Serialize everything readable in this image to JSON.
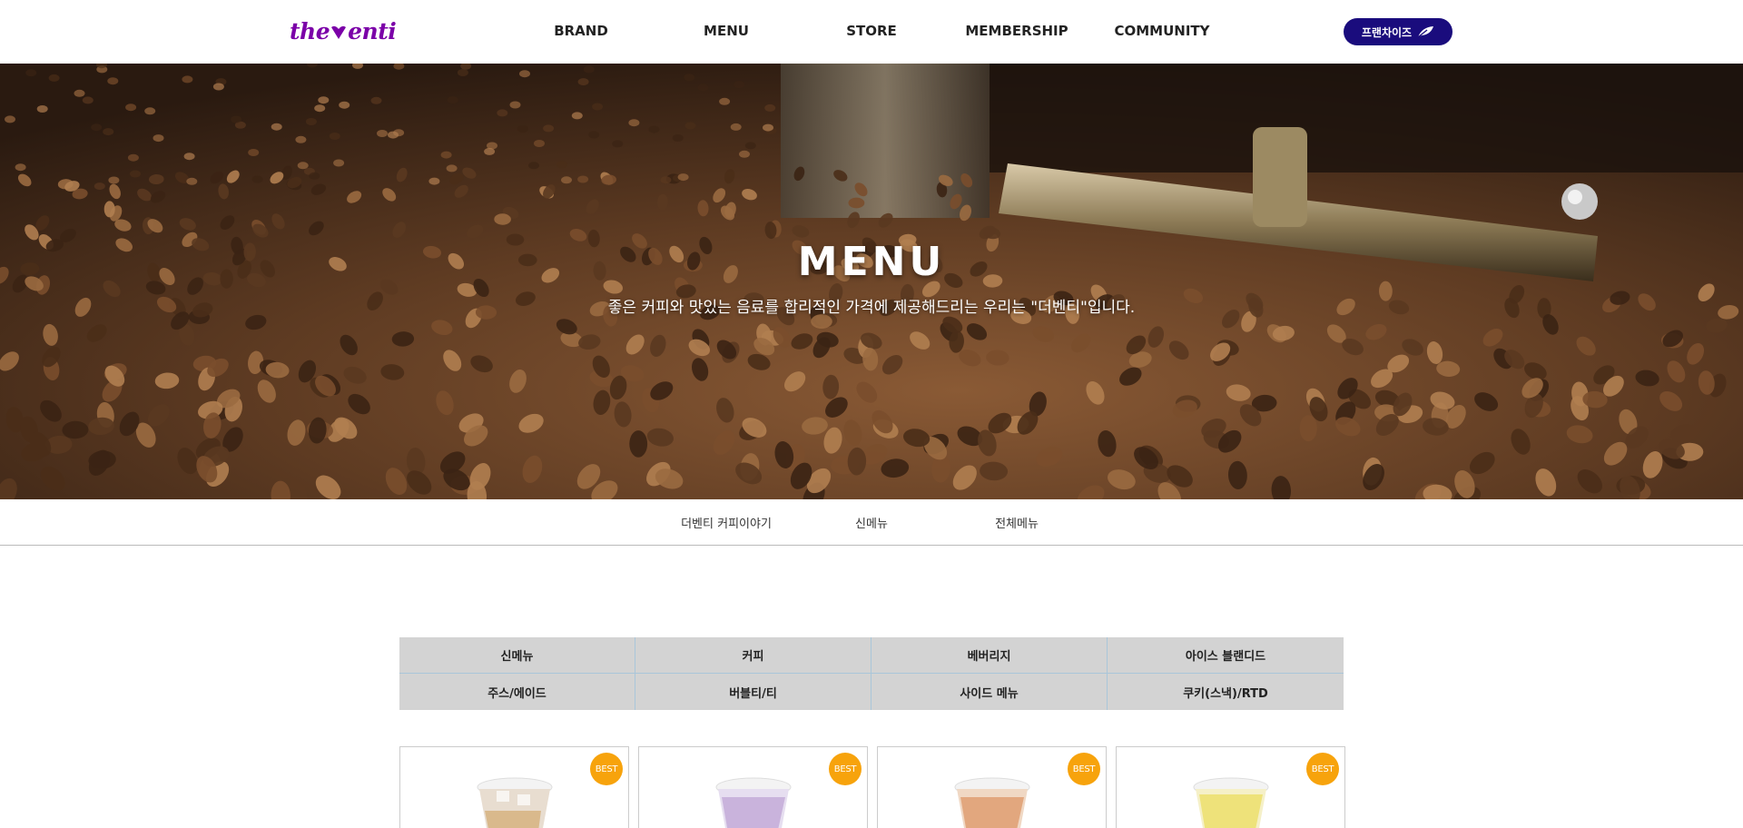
{
  "header": {
    "logo_text_left": "the",
    "logo_text_right": "enti",
    "nav": [
      "BRAND",
      "MENU",
      "STORE",
      "MEMBERSHIP",
      "COMMUNITY"
    ],
    "franchise_label": "프랜차이즈"
  },
  "hero": {
    "title": "MENU",
    "subtitle": "좋은 커피와 맛있는 음료를 합리적인 가격에 제공해드리는 우리는 \"더벤티\"입니다."
  },
  "subnav": [
    "더벤티 커피이야기",
    "신메뉴",
    "전체메뉴"
  ],
  "categories": [
    "신메뉴",
    "커피",
    "베버리지",
    "아이스 블랜디드",
    "주스/에이드",
    "버블티/티",
    "사이드 메뉴",
    "쿠키(스낵)/RTD"
  ],
  "products": [
    {
      "badge": "BEST",
      "drink_color": "#d9b98c"
    },
    {
      "badge": "BEST",
      "drink_color": "#c9b3dc"
    },
    {
      "badge": "BEST",
      "drink_color": "#e2a77e"
    },
    {
      "badge": "BEST",
      "drink_color": "#eee27a"
    }
  ],
  "colors": {
    "brand_purple": "#7b00a8",
    "franchise_button": "#1a0c7d",
    "badge": "#f7a30c",
    "category_bg": "#d3d3d3"
  }
}
